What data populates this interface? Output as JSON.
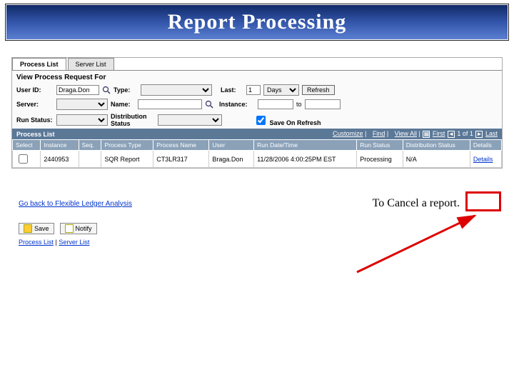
{
  "banner": {
    "title": "Report Processing"
  },
  "tabs": {
    "process_list": "Process List",
    "server_list": "Server List"
  },
  "section": {
    "view_for": "View Process Request For"
  },
  "filters": {
    "user_id_label": "User ID:",
    "user_id_value": "Draga.Don",
    "type_label": "Type:",
    "last_label": "Last:",
    "last_value": "1",
    "last_unit": "Days",
    "refresh": "Refresh",
    "server_label": "Server:",
    "name_label": "Name:",
    "instance_label": "Instance:",
    "to_label": "to",
    "run_status_label": "Run Status:",
    "dist_status_label": "Distribution Status",
    "save_on_refresh": "Save On Refresh"
  },
  "grid": {
    "bar_title": "Process List",
    "tools": {
      "customize": "Customize",
      "find": "Find",
      "view_all": "View All",
      "first": "First",
      "count": "1 of 1",
      "last": "Last"
    },
    "headers": {
      "select": "Select",
      "instance": "Instance",
      "seq": "Seq.",
      "process_type": "Process Type",
      "process_name": "Process Name",
      "user": "User",
      "run_datetime": "Run Date/Time",
      "run_status": "Run Status",
      "dist_status": "Distribution Status",
      "details": "Details"
    },
    "row": {
      "instance": "2440953",
      "seq": "",
      "process_type": "SQR Report",
      "process_name": "CT3LR317",
      "user": "Braga.Don",
      "run_datetime": "11/28/2006 4:00:25PM EST",
      "run_status": "Processing",
      "dist_status": "N/A",
      "details": "Details"
    }
  },
  "footer": {
    "go_back": "Go back to Flexible Ledger Analysis",
    "cancel_text": "To Cancel a report.",
    "save": "Save",
    "notify": "Notify",
    "nav_process_list": "Process List",
    "nav_server_list": "Server List"
  }
}
